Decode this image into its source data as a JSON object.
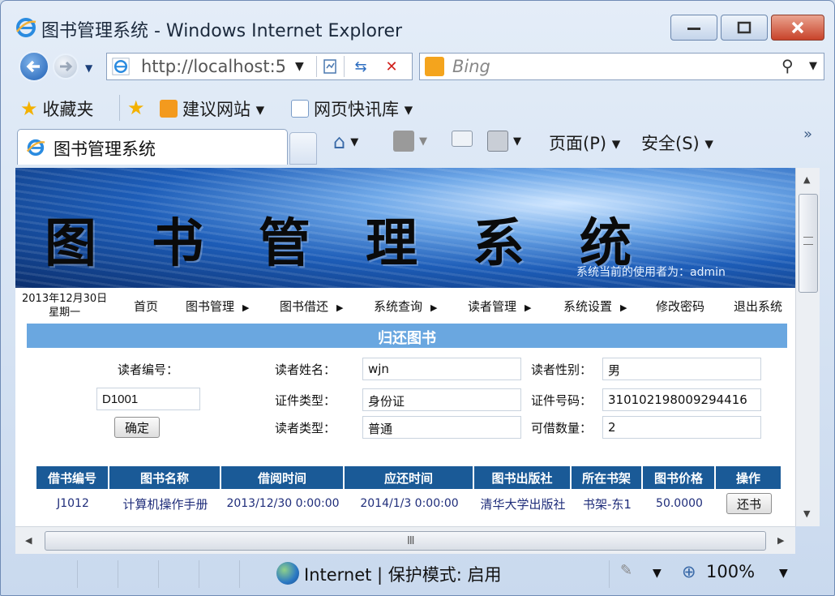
{
  "window": {
    "title": "图书管理系统 - Windows Internet Explorer"
  },
  "address_bar": {
    "url": "http://localhost:5",
    "search_placeholder": "Bing"
  },
  "favorites_bar": {
    "favorites_label": "收藏夹",
    "suggested_sites": "建议网站 ▾",
    "web_slice": "网页快讯库 ▾"
  },
  "tab": {
    "label": "图书管理系统"
  },
  "command_bar": {
    "page_menu": "页面(P) ▾",
    "safety_menu": "安全(S) ▾"
  },
  "page": {
    "banner_title": "图书管理系统",
    "current_user": "系统当前的使用者为：admin",
    "date_line1": "2013年12月30日",
    "date_line2": "星期一",
    "menu": [
      {
        "label": "首页",
        "has_arrow": false
      },
      {
        "label": "图书管理",
        "has_arrow": true
      },
      {
        "label": "图书借还",
        "has_arrow": true
      },
      {
        "label": "系统查询",
        "has_arrow": true
      },
      {
        "label": "读者管理",
        "has_arrow": true
      },
      {
        "label": "系统设置",
        "has_arrow": true
      },
      {
        "label": "修改密码",
        "has_arrow": false
      },
      {
        "label": "退出系统",
        "has_arrow": false
      }
    ],
    "section_title": "归还图书",
    "form": {
      "reader_id_label": "读者编号：",
      "reader_id_value": "D1001",
      "confirm_button": "确定",
      "reader_name_label": "读者姓名：",
      "reader_name_value": "wjn",
      "reader_gender_label": "读者性别：",
      "reader_gender_value": "男",
      "id_type_label": "证件类型：",
      "id_type_value": "身份证",
      "id_number_label": "证件号码：",
      "id_number_value": "310102198009294416",
      "reader_type_label": "读者类型：",
      "reader_type_value": "普通",
      "borrow_limit_label": "可借数量：",
      "borrow_limit_value": "2"
    },
    "table": {
      "headers": [
        "借书编号",
        "图书名称",
        "借阅时间",
        "应还时间",
        "图书出版社",
        "所在书架",
        "图书价格",
        "操作"
      ],
      "rows": [
        {
          "id": "J1012",
          "name": "计算机操作手册",
          "borrow_time": "2013/12/30 0:00:00",
          "due_time": "2014/1/3 0:00:00",
          "publisher": "清华大学出版社",
          "shelf": "书架-东1",
          "price": "50.0000",
          "action": "还书"
        }
      ]
    }
  },
  "status_bar": {
    "zone": "Internet | 保护模式: 启用",
    "zoom": "100%"
  },
  "colors": {
    "section_bar": "#6aa7e0",
    "table_header": "#1a5a97",
    "table_text": "#1f2d7a"
  }
}
